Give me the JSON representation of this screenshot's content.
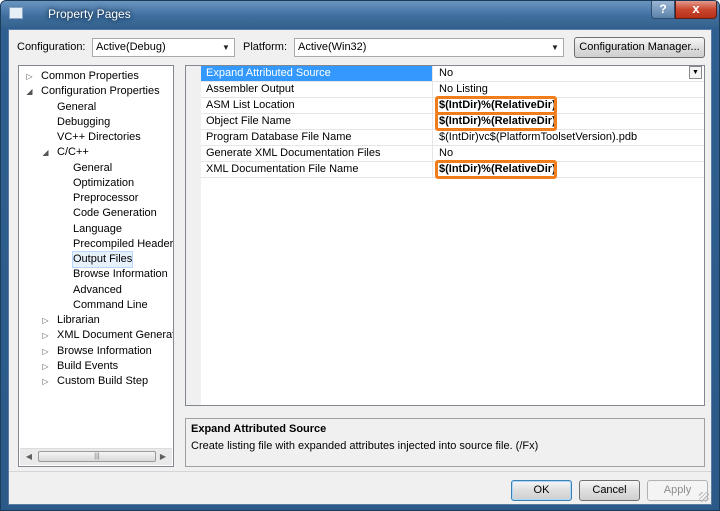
{
  "window": {
    "title": "Property Pages",
    "help_glyph": "?",
    "close_glyph": "x"
  },
  "toolbar": {
    "configuration_label": "Configuration:",
    "configuration_value": "Active(Debug)",
    "platform_label": "Platform:",
    "platform_value": "Active(Win32)",
    "config_manager_label": "Configuration Manager..."
  },
  "tree": {
    "items": [
      {
        "label": "Common Properties",
        "level": 0,
        "expander": "▷"
      },
      {
        "label": "Configuration Properties",
        "level": 0,
        "expander": "◢"
      },
      {
        "label": "General",
        "level": 1,
        "expander": ""
      },
      {
        "label": "Debugging",
        "level": 1,
        "expander": ""
      },
      {
        "label": "VC++ Directories",
        "level": 1,
        "expander": ""
      },
      {
        "label": "C/C++",
        "level": 1,
        "expander": "◢"
      },
      {
        "label": "General",
        "level": 2,
        "expander": ""
      },
      {
        "label": "Optimization",
        "level": 2,
        "expander": ""
      },
      {
        "label": "Preprocessor",
        "level": 2,
        "expander": ""
      },
      {
        "label": "Code Generation",
        "level": 2,
        "expander": ""
      },
      {
        "label": "Language",
        "level": 2,
        "expander": ""
      },
      {
        "label": "Precompiled Headers",
        "level": 2,
        "expander": ""
      },
      {
        "label": "Output Files",
        "level": 2,
        "expander": "",
        "selected": true
      },
      {
        "label": "Browse Information",
        "level": 2,
        "expander": ""
      },
      {
        "label": "Advanced",
        "level": 2,
        "expander": ""
      },
      {
        "label": "Command Line",
        "level": 2,
        "expander": ""
      },
      {
        "label": "Librarian",
        "level": 1,
        "expander": "▷"
      },
      {
        "label": "XML Document Generator",
        "level": 1,
        "expander": "▷"
      },
      {
        "label": "Browse Information",
        "level": 1,
        "expander": "▷"
      },
      {
        "label": "Build Events",
        "level": 1,
        "expander": "▷"
      },
      {
        "label": "Custom Build Step",
        "level": 1,
        "expander": "▷"
      }
    ]
  },
  "properties": {
    "rows": [
      {
        "name": "Expand Attributed Source",
        "value": "No",
        "selected": true,
        "bold": false,
        "highlight": false
      },
      {
        "name": "Assembler Output",
        "value": "No Listing",
        "selected": false,
        "bold": false,
        "highlight": false
      },
      {
        "name": "ASM List Location",
        "value": "$(IntDir)%(RelativeDir)",
        "selected": false,
        "bold": true,
        "highlight": true
      },
      {
        "name": "Object File Name",
        "value": "$(IntDir)%(RelativeDir)",
        "selected": false,
        "bold": true,
        "highlight": true
      },
      {
        "name": "Program Database File Name",
        "value": "$(IntDir)vc$(PlatformToolsetVersion).pdb",
        "selected": false,
        "bold": false,
        "highlight": false
      },
      {
        "name": "Generate XML Documentation Files",
        "value": "No",
        "selected": false,
        "bold": false,
        "highlight": false
      },
      {
        "name": "XML Documentation File Name",
        "value": "$(IntDir)%(RelativeDir)",
        "selected": false,
        "bold": true,
        "highlight": true
      }
    ],
    "highlight_color": "#f07d1a",
    "selection_color": "#3399ff"
  },
  "description": {
    "title": "Expand Attributed Source",
    "text": "Create listing file with expanded attributes injected into source file.     (/Fx)"
  },
  "footer": {
    "ok_label": "OK",
    "cancel_label": "Cancel",
    "apply_label": "Apply"
  }
}
